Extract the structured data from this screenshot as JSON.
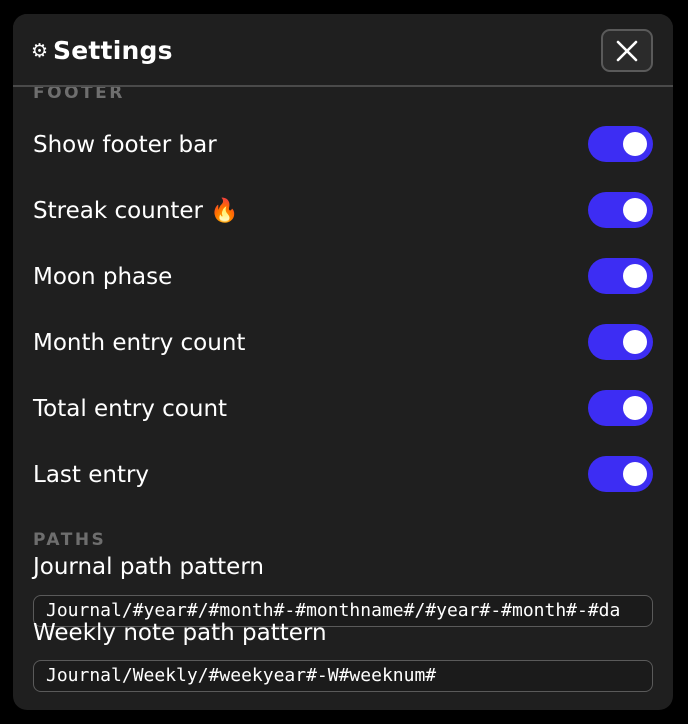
{
  "dialog": {
    "title": "Settings",
    "title_icon": "⚙",
    "close_icon": "close-icon"
  },
  "footer_section": {
    "label": "FOOTER",
    "toggles": [
      {
        "label": "Show footer bar",
        "on": true
      },
      {
        "label": "Streak counter 🔥",
        "on": true
      },
      {
        "label": "Moon phase",
        "on": true
      },
      {
        "label": "Month entry count",
        "on": true
      },
      {
        "label": "Total entry count",
        "on": true
      },
      {
        "label": "Last entry",
        "on": true
      }
    ]
  },
  "paths_section": {
    "label": "PATHS",
    "journal_label": "Journal path pattern",
    "journal_value": "Journal/#year#/#month#-#monthname#/#year#-#month#-#da",
    "weekly_label": "Weekly note path pattern",
    "weekly_value": "Journal/Weekly/#weekyear#-W#weeknum#"
  },
  "colors": {
    "toggle_on": "#3d2df3",
    "background": "#1f1f1f",
    "section_label": "#6e6e6e"
  }
}
